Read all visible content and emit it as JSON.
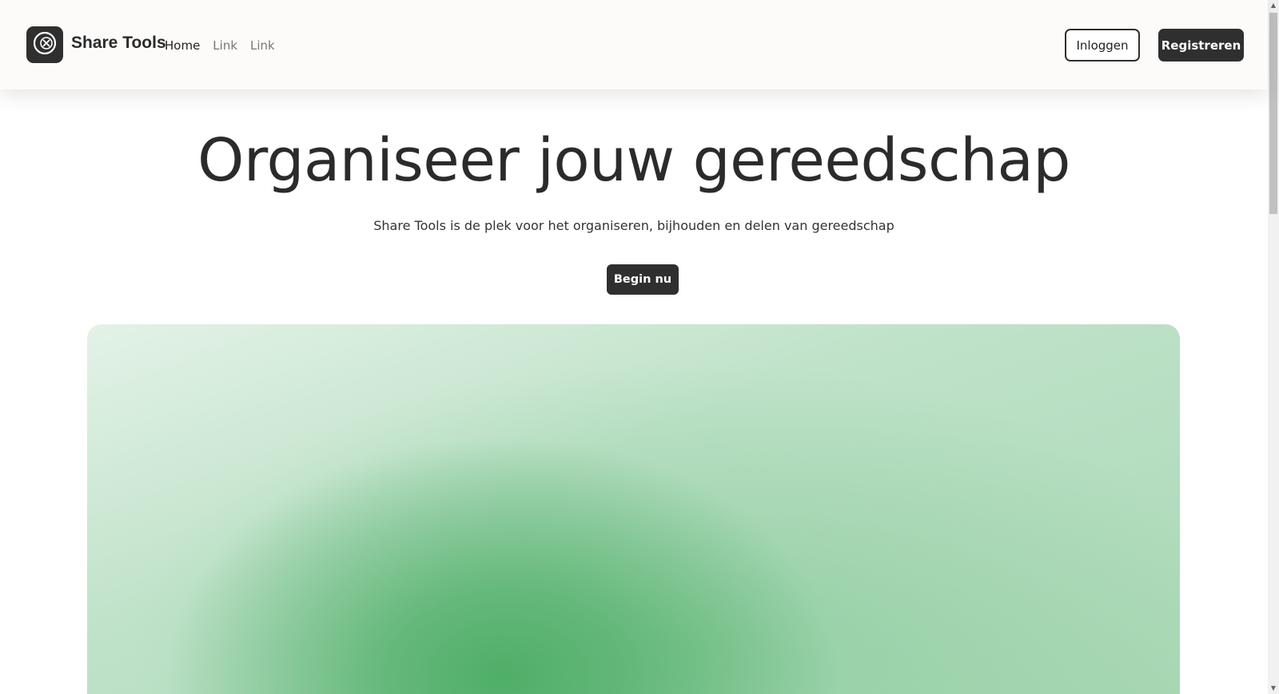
{
  "header": {
    "brand": "Share Tools",
    "logo_icon": "tools-icon",
    "nav": [
      {
        "label": "Home",
        "active": true
      },
      {
        "label": "Link",
        "active": false
      },
      {
        "label": "Link",
        "active": false
      }
    ],
    "login_label": "Inloggen",
    "register_label": "Registreren"
  },
  "hero": {
    "title": "Organiseer jouw gereedschap",
    "subtitle": "Share Tools is de plek voor het organiseren, bijhouden en delen van gereedschap",
    "cta_label": "Begin nu"
  },
  "scrollbar": {
    "up_icon": "scroll-up-arrow-icon",
    "down_icon": "scroll-down-arrow-icon"
  },
  "colors": {
    "dark": "#2f2f2f",
    "header_bg": "#fcfbfa",
    "accent_green": "#4fae68"
  }
}
